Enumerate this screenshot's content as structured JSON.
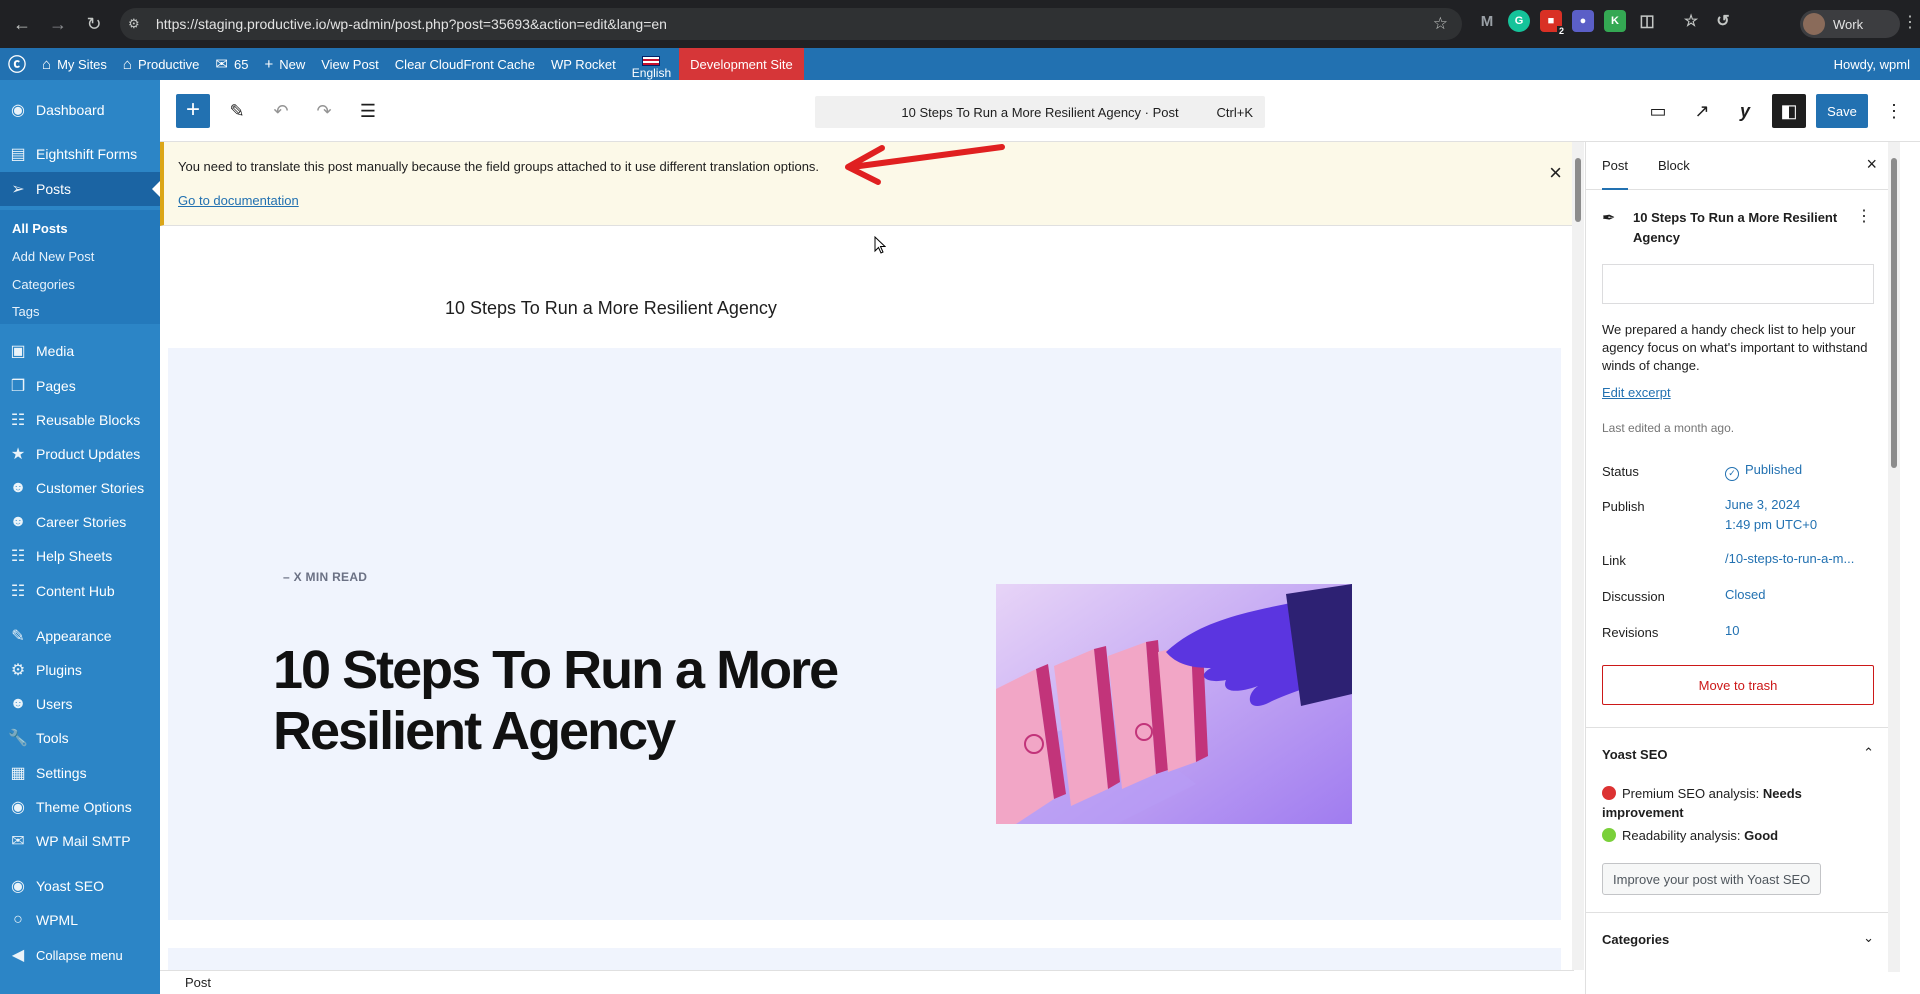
{
  "browser": {
    "url": "https://staging.productive.io/wp-admin/post.php?post=35693&action=edit&lang=en",
    "profile": "Work",
    "badge_count": "2"
  },
  "adminbar": {
    "my_sites": "My Sites",
    "site_name": "Productive",
    "comments": "65",
    "new": "New",
    "view_post": "View Post",
    "clear_cache": "Clear CloudFront Cache",
    "wp_rocket": "WP Rocket",
    "language": "English",
    "dev_site": "Development Site",
    "howdy": "Howdy, wpml"
  },
  "sidebar": {
    "items": [
      {
        "label": "Dashboard",
        "icon": "dashboard-icon"
      },
      {
        "label": "Eightshift Forms",
        "icon": "forms-icon"
      },
      {
        "label": "Posts",
        "icon": "pin-icon"
      },
      {
        "label": "Media",
        "icon": "media-icon"
      },
      {
        "label": "Pages",
        "icon": "pages-icon"
      },
      {
        "label": "Reusable Blocks",
        "icon": "blocks-icon"
      },
      {
        "label": "Product Updates",
        "icon": "star-icon"
      },
      {
        "label": "Customer Stories",
        "icon": "user-icon"
      },
      {
        "label": "Career Stories",
        "icon": "user-icon"
      },
      {
        "label": "Help Sheets",
        "icon": "sheet-icon"
      },
      {
        "label": "Content Hub",
        "icon": "hub-icon"
      },
      {
        "label": "Appearance",
        "icon": "brush-icon"
      },
      {
        "label": "Plugins",
        "icon": "plugin-icon"
      },
      {
        "label": "Users",
        "icon": "users-icon"
      },
      {
        "label": "Tools",
        "icon": "wrench-icon"
      },
      {
        "label": "Settings",
        "icon": "settings-icon"
      },
      {
        "label": "Theme Options",
        "icon": "theme-icon"
      },
      {
        "label": "WP Mail SMTP",
        "icon": "mail-icon"
      },
      {
        "label": "Yoast SEO",
        "icon": "yoast-icon"
      },
      {
        "label": "WPML",
        "icon": "wpml-icon"
      },
      {
        "label": "Collapse menu",
        "icon": "collapse-icon"
      }
    ],
    "submenu": [
      "All Posts",
      "Add New Post",
      "Categories",
      "Tags"
    ]
  },
  "editor": {
    "command_title": "10 Steps To Run a More Resilient Agency · Post",
    "shortcut": "Ctrl+K",
    "save": "Save"
  },
  "notice": {
    "message": "You need to translate this post manually because the field groups attached to it use different translation options.",
    "link": "Go to documentation"
  },
  "canvas": {
    "title_field": "10 Steps To Run a More Resilient Agency",
    "kicker": "–   X MIN READ",
    "hero_title": "10 Steps To Run a More Resilient Agency"
  },
  "footer": {
    "breadcrumb": "Post"
  },
  "inspector": {
    "tab_post": "Post",
    "tab_block": "Block",
    "card_title": "10 Steps To Run a More Resilient Agency",
    "excerpt": "We prepared a handy check list to help your agency focus on what's important to withstand winds of change.",
    "edit_excerpt": "Edit excerpt",
    "last_edited": "Last edited a month ago.",
    "props": {
      "status_label": "Status",
      "status_value": "Published",
      "publish_label": "Publish",
      "publish_date": "June 3, 2024",
      "publish_time": "1:49 pm UTC+0",
      "link_label": "Link",
      "link_value": "/10-steps-to-run-a-m...",
      "discussion_label": "Discussion",
      "discussion_value": "Closed",
      "revisions_label": "Revisions",
      "revisions_value": "10"
    },
    "trash": "Move to trash",
    "yoast": {
      "heading": "Yoast SEO",
      "seo_label": "Premium SEO analysis:",
      "seo_value": "Needs improvement",
      "read_label": "Readability analysis:",
      "read_value": "Good",
      "button": "Improve your post with Yoast SEO"
    },
    "categories_heading": "Categories"
  },
  "colors": {
    "adminbar": "#2271b1",
    "sidebar": "#2c85c6",
    "accent": "#2271b1",
    "danger": "#cc1818",
    "dev_site": "#d63638"
  }
}
